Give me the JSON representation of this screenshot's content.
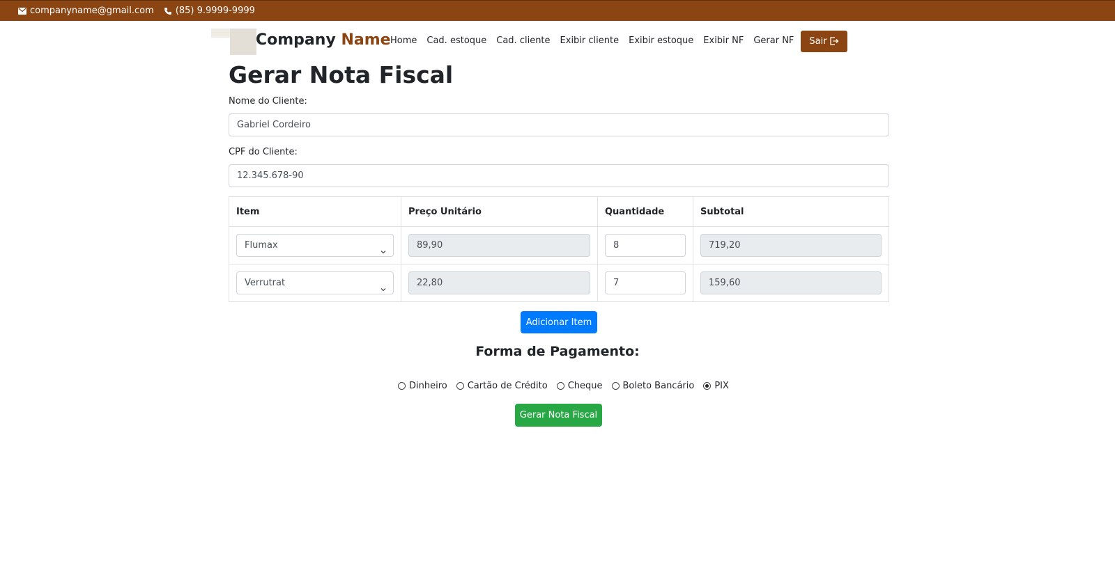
{
  "topbar": {
    "email": "companyname@gmail.com",
    "email_icon": "envelope-icon",
    "phone": "(85) 9.9999-9999",
    "phone_icon": "phone-icon"
  },
  "navbar": {
    "brand_main": "Company",
    "brand_accent": "Name",
    "links": [
      "Home",
      "Cad. estoque",
      "Cad. cliente",
      "Exibir cliente",
      "Exibir estoque",
      "Exibir NF",
      "Gerar NF"
    ],
    "logout_label": "Sair",
    "logout_icon": "logout-icon"
  },
  "page": {
    "title": "Gerar Nota Fiscal",
    "client_name_label": "Nome do Cliente:",
    "client_name_value": "Gabriel Cordeiro",
    "client_cpf_label": "CPF do Cliente:",
    "client_cpf_value": "12.345.678-90"
  },
  "table": {
    "headers": [
      "Item",
      "Preço Unitário",
      "Quantidade",
      "Subtotal"
    ],
    "rows": [
      {
        "item": "Flumax",
        "price": "89,90",
        "quantity": "8",
        "subtotal": "719,20"
      },
      {
        "item": "Verrutrat",
        "price": "22,80",
        "quantity": "7",
        "subtotal": "159,60"
      }
    ]
  },
  "actions": {
    "add_item_label": "Adicionar Item",
    "generate_label": "Gerar Nota Fiscal"
  },
  "payment": {
    "title": "Forma de Pagamento:",
    "options": [
      "Dinheiro",
      "Cartão de Crédito",
      "Cheque",
      "Boleto Bancário",
      "PIX"
    ],
    "selected": "PIX"
  },
  "colors": {
    "brand": "#8b4513",
    "primary": "#007bff",
    "success": "#28a745"
  }
}
